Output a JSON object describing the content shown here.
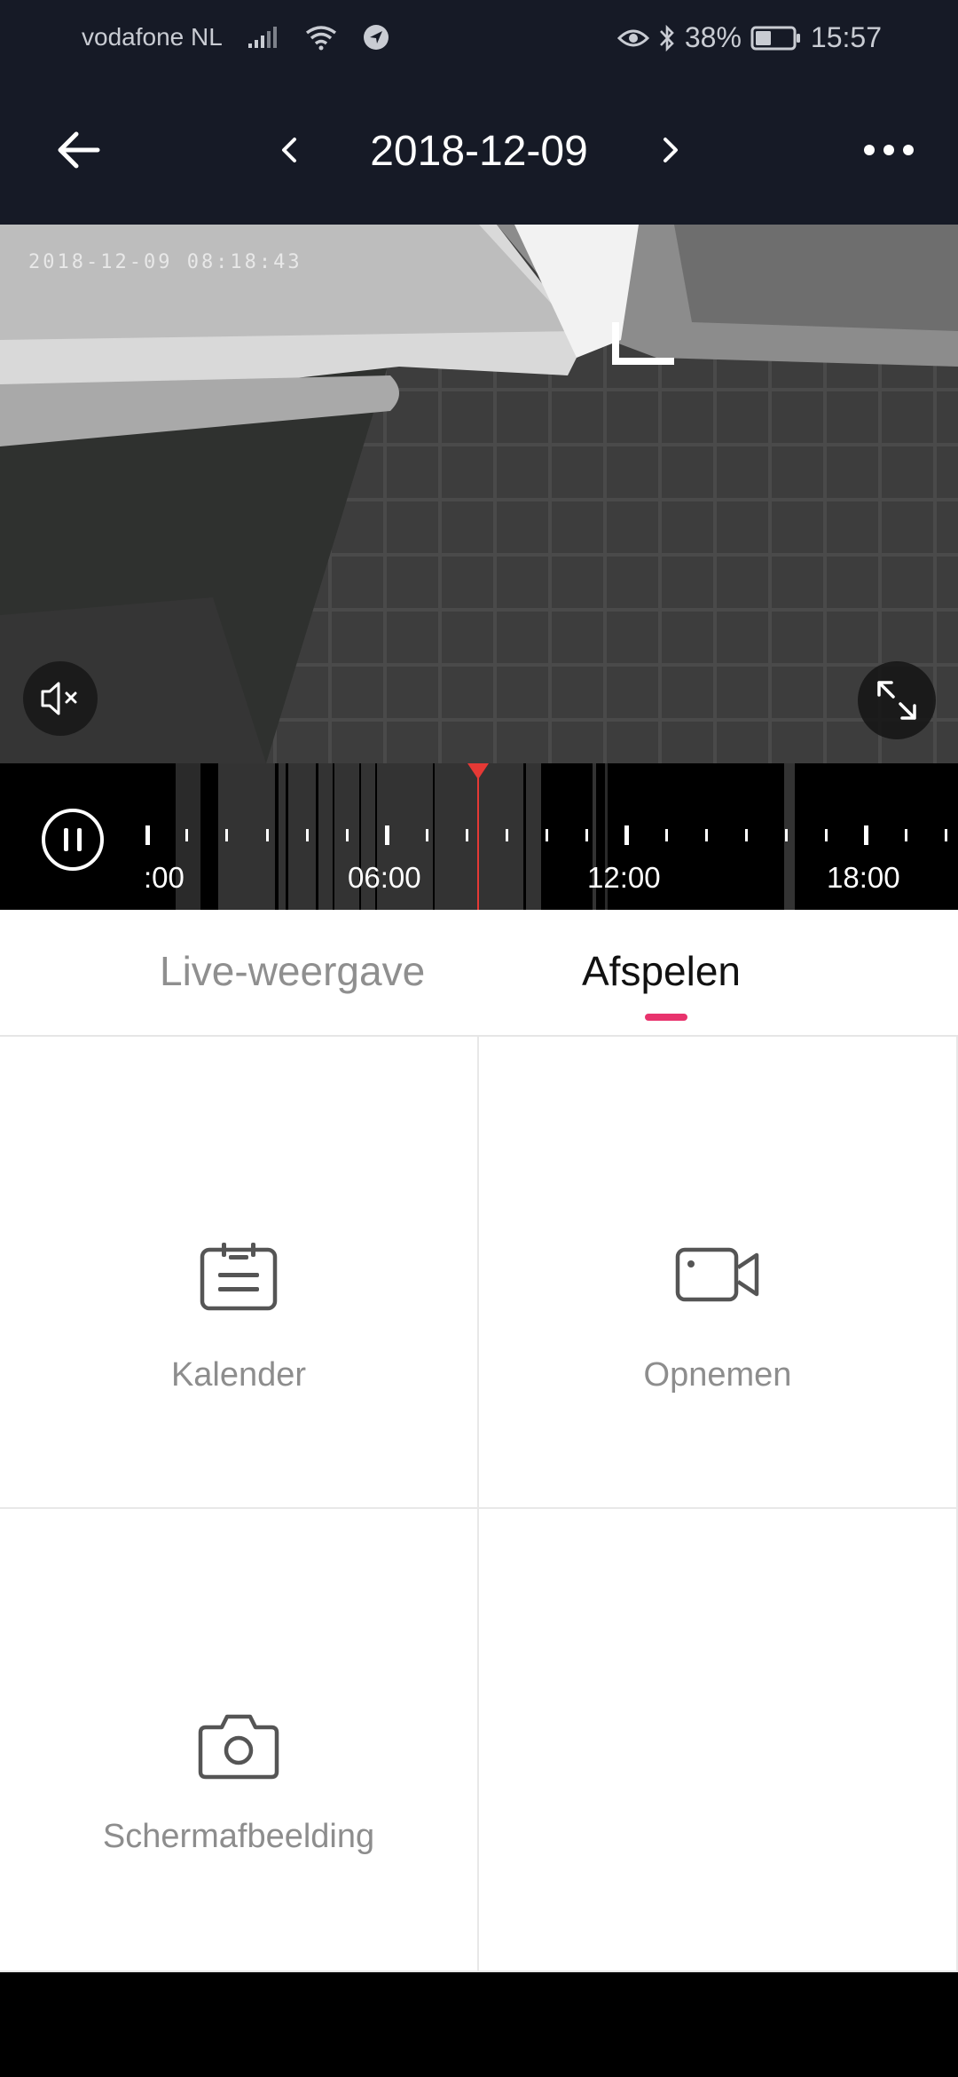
{
  "status_bar": {
    "carrier": "vodafone NL",
    "battery": "38%",
    "time": "15:57"
  },
  "header": {
    "date": "2018-12-09",
    "icons": [
      "back-arrow-icon",
      "chevron-left-icon",
      "chevron-right-icon",
      "more-icon"
    ]
  },
  "video": {
    "osd_timestamp": "2018-12-09 08:18:43",
    "icons": [
      "mute-icon",
      "fullscreen-icon"
    ]
  },
  "timeline": {
    "labels": [
      ":00",
      "06:00",
      "12:00",
      "18:00"
    ],
    "playhead_time": "08:18",
    "accent_color": "#e53935"
  },
  "tabs": {
    "live": "Live-weergave",
    "playback": "Afspelen",
    "active": "playback",
    "indicator_color": "#e8336d"
  },
  "actions": {
    "calendar": "Kalender",
    "record": "Opnemen",
    "screenshot": "Schermafbeelding"
  }
}
